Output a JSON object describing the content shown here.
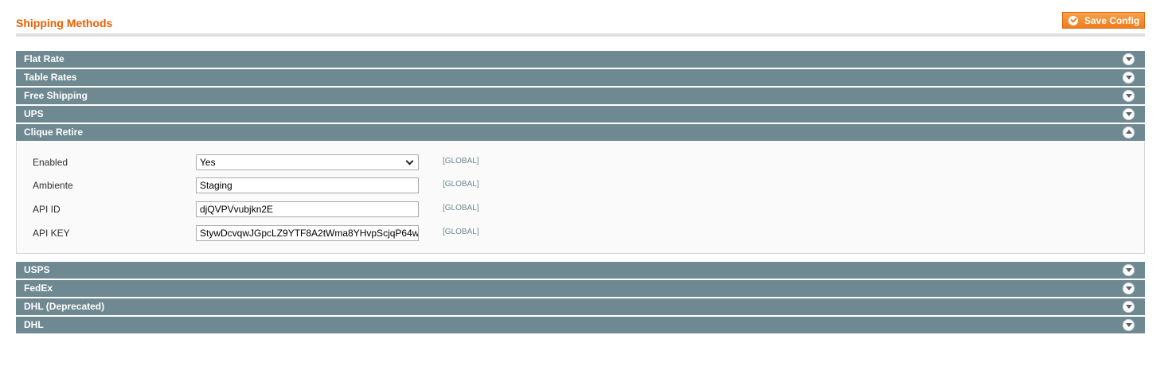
{
  "header": {
    "title": "Shipping Methods",
    "save_label": "Save Config"
  },
  "sections_before": [
    {
      "label": "Flat Rate"
    },
    {
      "label": "Table Rates"
    },
    {
      "label": "Free Shipping"
    },
    {
      "label": "UPS"
    }
  ],
  "open_section": {
    "label": "Clique Retire",
    "fields": [
      {
        "label": "Enabled",
        "value": "Yes",
        "scope": "[GLOBAL]"
      },
      {
        "label": "Ambiente",
        "value": "Staging",
        "scope": "[GLOBAL]"
      },
      {
        "label": "API ID",
        "value": "djQVPVvubjkn2E",
        "scope": "[GLOBAL]"
      },
      {
        "label": "API KEY",
        "value": "StywDcvqwJGpcLZ9YTF8A2tWma8YHvpScjqP64w",
        "scope": "[GLOBAL]"
      }
    ]
  },
  "sections_after": [
    {
      "label": "USPS"
    },
    {
      "label": "FedEx"
    },
    {
      "label": "DHL (Deprecated)"
    },
    {
      "label": "DHL"
    }
  ],
  "colors": {
    "accent": "#eb5e00",
    "section_header": "#6f8992",
    "button": "#ef7c1d"
  }
}
